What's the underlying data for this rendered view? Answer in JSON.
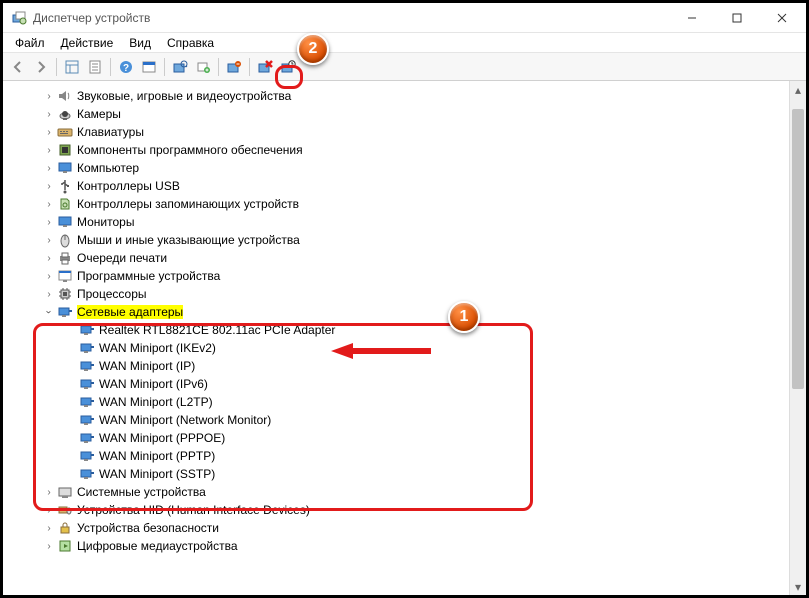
{
  "window": {
    "title": "Диспетчер устройств"
  },
  "menu": {
    "file": "Файл",
    "action": "Действие",
    "view": "Вид",
    "help": "Справка"
  },
  "callouts": {
    "c1": "1",
    "c2": "2"
  },
  "tree": {
    "sound": "Звуковые, игровые и видеоустройства",
    "cameras": "Камеры",
    "keyboards": "Клавиатуры",
    "software_components": "Компоненты программного обеспечения",
    "computer": "Компьютер",
    "usb_controllers": "Контроллеры USB",
    "storage_controllers": "Контроллеры запоминающих устройств",
    "monitors": "Мониторы",
    "mice": "Мыши и иные указывающие устройства",
    "print_queues": "Очереди печати",
    "software_devices": "Программные устройства",
    "processors": "Процессоры",
    "network_adapters": "Сетевые адаптеры",
    "na_realtek": "Realtek RTL8821CE 802.11ac PCIe Adapter",
    "na_ikev2": "WAN Miniport (IKEv2)",
    "na_ip": "WAN Miniport (IP)",
    "na_ipv6": "WAN Miniport (IPv6)",
    "na_l2tp": "WAN Miniport (L2TP)",
    "na_netmon": "WAN Miniport (Network Monitor)",
    "na_pppoe": "WAN Miniport (PPPOE)",
    "na_pptp": "WAN Miniport (PPTP)",
    "na_sstp": "WAN Miniport (SSTP)",
    "system_devices": "Системные устройства",
    "hid": "Устройства HID (Human Interface Devices)",
    "security_devices": "Устройства безопасности",
    "digital_media": "Цифровые медиаустройства"
  }
}
